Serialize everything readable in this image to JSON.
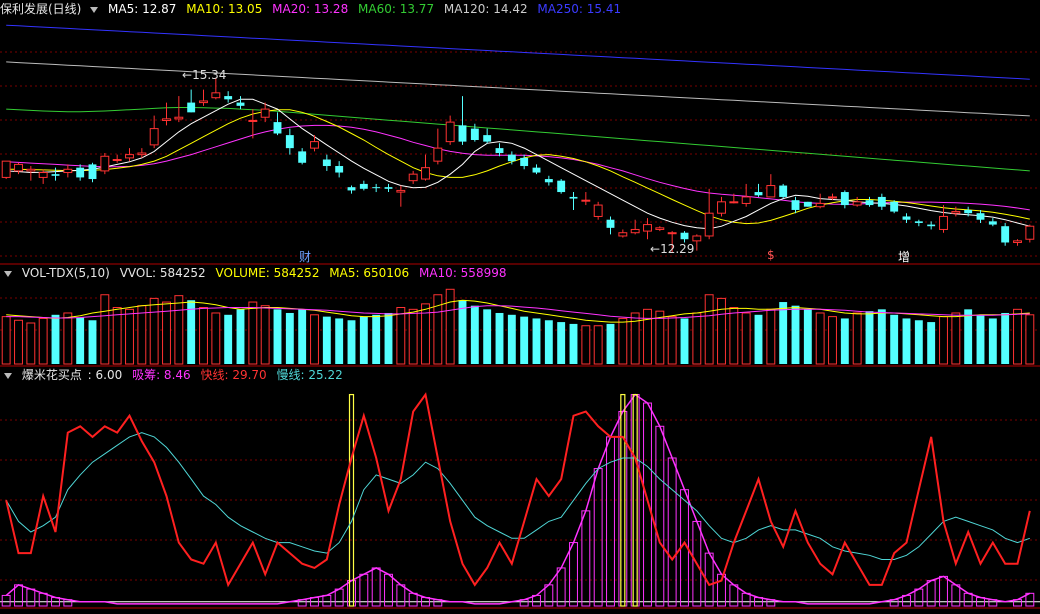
{
  "panel1": {
    "stock_name": "保利发展(日线)",
    "ma5": "MA5: 12.87",
    "ma10": "MA10: 13.05",
    "ma20": "MA20: 13.28",
    "ma60": "MA60: 13.77",
    "ma120": "MA120: 14.42",
    "ma250": "MA250: 15.41",
    "high_label": "15.34",
    "low_label": "12.29",
    "markers": [
      "财",
      "$",
      "增"
    ]
  },
  "panel2": {
    "name": "VOL-TDX(5,10)",
    "vvol": "VVOL: 584252",
    "volume": "VOLUME: 584252",
    "ma5": "MA5: 650106",
    "ma10": "MA10: 558998"
  },
  "panel3": {
    "name": "爆米花买点",
    "value": ": 6.00",
    "xichou": "吸筹: 8.46",
    "kuaixian": "快线: 29.70",
    "manxian": "慢线: 25.22"
  },
  "colors": {
    "up": "#ff3232",
    "down": "#54ffff",
    "ma5": "#ffffff",
    "ma10": "#ffff00",
    "ma20": "#ff33ff",
    "ma60": "#33cc33",
    "ma120": "#bbbbbb",
    "ma250": "#3333ff",
    "grid": "#7a0000",
    "fast": "#ff2020",
    "slow": "#4fd6d6",
    "suck": "#ff33ff",
    "signal": "#ffff44"
  },
  "chart_data": {
    "candles": [
      [
        12.3,
        12.8,
        12.4,
        12.25
      ],
      [
        12.5,
        12.7,
        12.75,
        12.4
      ],
      [
        12.5,
        12.55,
        12.65,
        12.2
      ],
      [
        12.3,
        12.45,
        12.55,
        12.1
      ],
      [
        12.4,
        12.35,
        12.6,
        12.2
      ],
      [
        12.45,
        12.55,
        12.7,
        12.3
      ],
      [
        12.6,
        12.3,
        12.7,
        12.2
      ],
      [
        12.7,
        12.25,
        12.75,
        12.15
      ],
      [
        12.5,
        12.95,
        13.05,
        12.4
      ],
      [
        12.85,
        12.85,
        13.0,
        12.75
      ],
      [
        12.9,
        13.0,
        13.2,
        12.8
      ],
      [
        13.0,
        13.05,
        13.2,
        12.9
      ],
      [
        13.3,
        13.8,
        14.2,
        13.2
      ],
      [
        14.05,
        14.1,
        14.6,
        13.9
      ],
      [
        14.1,
        14.15,
        14.8,
        14.0
      ],
      [
        14.6,
        14.3,
        15.0,
        14.3
      ],
      [
        14.6,
        14.65,
        15.0,
        14.5
      ],
      [
        14.75,
        14.9,
        15.34,
        14.7
      ],
      [
        14.8,
        14.7,
        14.95,
        14.6
      ],
      [
        14.6,
        14.5,
        14.8,
        14.4
      ],
      [
        14.05,
        14.05,
        14.4,
        13.5
      ],
      [
        14.15,
        14.4,
        14.6,
        14.0
      ],
      [
        14.0,
        13.65,
        14.3,
        13.6
      ],
      [
        13.6,
        13.2,
        13.8,
        13.0
      ],
      [
        13.1,
        12.75,
        13.2,
        12.7
      ],
      [
        13.2,
        13.4,
        13.6,
        13.1
      ],
      [
        12.85,
        12.65,
        13.0,
        12.5
      ],
      [
        12.65,
        12.45,
        12.8,
        12.3
      ],
      [
        12.0,
        11.9,
        12.05,
        11.8
      ],
      [
        12.1,
        11.95,
        12.2,
        11.9
      ],
      [
        12.0,
        11.98,
        12.1,
        11.85
      ],
      [
        12.0,
        11.95,
        12.1,
        11.85
      ],
      [
        11.85,
        11.9,
        12.05,
        11.4
      ],
      [
        12.2,
        12.4,
        12.5,
        12.1
      ],
      [
        12.25,
        12.6,
        13.0,
        12.2
      ],
      [
        12.8,
        13.2,
        13.8,
        12.7
      ],
      [
        13.4,
        14.0,
        14.2,
        13.3
      ],
      [
        13.9,
        13.4,
        14.8,
        13.3
      ],
      [
        13.8,
        13.45,
        13.95,
        13.4
      ],
      [
        13.6,
        13.4,
        13.8,
        13.35
      ],
      [
        13.2,
        13.05,
        13.35,
        12.95
      ],
      [
        13.0,
        12.8,
        13.1,
        12.7
      ],
      [
        12.9,
        12.65,
        13.0,
        12.55
      ],
      [
        12.6,
        12.45,
        12.7,
        12.4
      ],
      [
        12.25,
        12.15,
        12.35,
        12.05
      ],
      [
        12.2,
        11.85,
        12.25,
        11.8
      ],
      [
        11.7,
        11.65,
        11.85,
        11.3
      ],
      [
        11.6,
        11.6,
        11.85,
        11.45
      ],
      [
        11.1,
        11.45,
        11.55,
        11.0
      ],
      [
        11.0,
        10.75,
        11.1,
        10.55
      ],
      [
        10.5,
        10.6,
        10.7,
        10.45
      ],
      [
        10.6,
        10.7,
        11.0,
        10.55
      ],
      [
        10.65,
        10.85,
        11.05,
        10.4
      ],
      [
        10.7,
        10.75,
        10.8,
        10.65
      ],
      [
        10.6,
        10.6,
        10.65,
        10.0
      ],
      [
        10.6,
        10.4,
        10.65,
        10.3
      ],
      [
        10.35,
        10.5,
        10.55,
        10.05
      ],
      [
        10.5,
        11.2,
        11.95,
        10.4
      ],
      [
        11.2,
        11.55,
        11.7,
        11.1
      ],
      [
        11.55,
        11.55,
        11.8,
        11.5
      ],
      [
        11.5,
        11.7,
        12.1,
        11.4
      ],
      [
        11.85,
        11.75,
        12.1,
        11.7
      ],
      [
        11.7,
        12.05,
        12.4,
        11.7
      ],
      [
        12.05,
        11.7,
        12.1,
        11.65
      ],
      [
        11.6,
        11.3,
        11.7,
        11.2
      ],
      [
        11.55,
        11.4,
        11.55,
        11.4
      ],
      [
        11.4,
        11.5,
        11.8,
        11.35
      ],
      [
        11.7,
        11.7,
        11.8,
        11.6
      ],
      [
        11.85,
        11.45,
        11.9,
        11.35
      ],
      [
        11.45,
        11.55,
        11.7,
        11.4
      ],
      [
        11.6,
        11.45,
        11.7,
        11.4
      ],
      [
        11.7,
        11.4,
        11.8,
        11.3
      ],
      [
        11.55,
        11.25,
        11.6,
        11.2
      ],
      [
        11.1,
        11.0,
        11.2,
        10.9
      ],
      [
        10.95,
        10.9,
        11.0,
        10.8
      ],
      [
        10.85,
        10.8,
        10.95,
        10.7
      ],
      [
        10.7,
        11.1,
        11.45,
        10.6
      ],
      [
        11.2,
        11.25,
        11.4,
        11.1
      ],
      [
        11.3,
        11.2,
        11.4,
        11.1
      ],
      [
        11.2,
        11.0,
        11.3,
        10.9
      ],
      [
        10.95,
        10.85,
        11.05,
        10.8
      ],
      [
        10.8,
        10.3,
        10.9,
        10.2
      ],
      [
        10.3,
        10.35,
        10.4,
        10.2
      ],
      [
        10.4,
        10.8,
        10.85,
        10.3
      ]
    ],
    "ma5": [
      12.5,
      12.48,
      12.45,
      12.46,
      12.48,
      12.5,
      12.52,
      12.55,
      12.62,
      12.7,
      12.78,
      12.9,
      13.1,
      13.4,
      13.7,
      13.95,
      14.15,
      14.35,
      14.55,
      14.7,
      14.7,
      14.55,
      14.4,
      14.1,
      13.8,
      13.55,
      13.3,
      13.05,
      12.8,
      12.58,
      12.38,
      12.18,
      12.05,
      11.98,
      12.0,
      12.15,
      12.4,
      12.7,
      13.1,
      13.35,
      13.4,
      13.35,
      13.2,
      13.0,
      12.8,
      12.6,
      12.4,
      12.2,
      12.0,
      11.8,
      11.6,
      11.4,
      11.2,
      11.05,
      10.92,
      10.82,
      10.75,
      10.72,
      10.8,
      10.95,
      11.1,
      11.3,
      11.5,
      11.65,
      11.75,
      11.72,
      11.65,
      11.62,
      11.6,
      11.55,
      11.52,
      11.5,
      11.47,
      11.42,
      11.35,
      11.28,
      11.22,
      11.18,
      11.15,
      11.12,
      11.08,
      11.0,
      10.9,
      10.8
    ],
    "ma10": [
      12.55,
      12.55,
      12.54,
      12.53,
      12.52,
      12.51,
      12.51,
      12.52,
      12.54,
      12.58,
      12.63,
      12.7,
      12.8,
      12.95,
      13.15,
      13.35,
      13.55,
      13.75,
      13.95,
      14.12,
      14.25,
      14.33,
      14.38,
      14.38,
      14.3,
      14.18,
      14.02,
      13.85,
      13.65,
      13.45,
      13.22,
      13.0,
      12.8,
      12.6,
      12.45,
      12.35,
      12.3,
      12.3,
      12.38,
      12.5,
      12.65,
      12.78,
      12.9,
      12.98,
      13.0,
      12.95,
      12.88,
      12.78,
      12.65,
      12.5,
      12.32,
      12.15,
      11.97,
      11.8,
      11.62,
      11.45,
      11.28,
      11.12,
      11.0,
      10.92,
      10.88,
      10.9,
      10.98,
      11.1,
      11.22,
      11.35,
      11.45,
      11.52,
      11.58,
      11.62,
      11.62,
      11.6,
      11.57,
      11.53,
      11.48,
      11.42,
      11.37,
      11.33,
      11.3,
      11.27,
      11.23,
      11.17,
      11.1,
      11.02
    ],
    "ma20": [
      12.78,
      12.76,
      12.74,
      12.72,
      12.7,
      12.68,
      12.66,
      12.64,
      12.63,
      12.63,
      12.64,
      12.67,
      12.72,
      12.8,
      12.9,
      13.0,
      13.12,
      13.24,
      13.36,
      13.48,
      13.6,
      13.7,
      13.78,
      13.84,
      13.88,
      13.9,
      13.9,
      13.88,
      13.84,
      13.78,
      13.7,
      13.6,
      13.5,
      13.38,
      13.28,
      13.18,
      13.1,
      13.04,
      13.0,
      12.98,
      12.98,
      12.98,
      12.98,
      12.96,
      12.94,
      12.9,
      12.85,
      12.78,
      12.7,
      12.6,
      12.5,
      12.38,
      12.26,
      12.15,
      12.05,
      11.96,
      11.88,
      11.82,
      11.78,
      11.75,
      11.72,
      11.68,
      11.64,
      11.6,
      11.55,
      11.52,
      11.5,
      11.48,
      11.47,
      11.48,
      11.5,
      11.52,
      11.53,
      11.54,
      11.54,
      11.54,
      11.53,
      11.52,
      11.5,
      11.48,
      11.45,
      11.41,
      11.36,
      11.3
    ],
    "ma60": [
      14.4,
      14.38,
      14.36,
      14.34,
      14.33,
      14.32,
      14.32,
      14.33,
      14.34,
      14.36,
      14.38,
      14.4,
      14.42,
      14.44,
      14.45,
      14.45,
      14.44,
      14.43,
      14.42,
      14.4,
      14.38,
      14.36,
      14.33,
      14.3,
      14.27,
      14.24,
      14.21,
      14.18,
      14.15,
      14.12,
      14.09,
      14.06,
      14.03,
      14.0,
      13.97,
      13.94,
      13.91,
      13.88,
      13.85,
      13.82,
      13.79,
      13.76,
      13.73,
      13.7,
      13.67,
      13.64,
      13.61,
      13.58,
      13.55,
      13.52,
      13.49,
      13.46,
      13.43,
      13.4,
      13.37,
      13.34,
      13.31,
      13.28,
      13.25,
      13.22,
      13.19,
      13.16,
      13.13,
      13.1,
      13.07,
      13.04,
      13.01,
      12.98,
      12.95,
      12.92,
      12.89,
      12.86,
      12.83,
      12.8,
      12.77,
      12.74,
      12.71,
      12.68,
      12.65,
      12.62,
      12.59,
      12.56,
      12.53,
      12.5
    ],
    "ma120": [
      15.85,
      15.83,
      15.81,
      15.79,
      15.77,
      15.75,
      15.73,
      15.71,
      15.69,
      15.67,
      15.65,
      15.63,
      15.61,
      15.59,
      15.57,
      15.55,
      15.53,
      15.51,
      15.49,
      15.47,
      15.45,
      15.43,
      15.41,
      15.39,
      15.37,
      15.35,
      15.33,
      15.31,
      15.29,
      15.27,
      15.25,
      15.23,
      15.21,
      15.19,
      15.17,
      15.15,
      15.13,
      15.11,
      15.09,
      15.07,
      15.05,
      15.03,
      15.01,
      14.99,
      14.97,
      14.95,
      14.93,
      14.91,
      14.89,
      14.87,
      14.85,
      14.83,
      14.81,
      14.79,
      14.77,
      14.75,
      14.73,
      14.71,
      14.69,
      14.67,
      14.65,
      14.63,
      14.61,
      14.59,
      14.57,
      14.55,
      14.53,
      14.51,
      14.49,
      14.47,
      14.45,
      14.43,
      14.41,
      14.39,
      14.37,
      14.35,
      14.33,
      14.31,
      14.29,
      14.27,
      14.25,
      14.23,
      14.21,
      14.19
    ],
    "ma250": [
      16.98,
      16.96,
      16.94,
      16.92,
      16.9,
      16.88,
      16.86,
      16.84,
      16.82,
      16.8,
      16.78,
      16.76,
      16.74,
      16.72,
      16.7,
      16.68,
      16.66,
      16.64,
      16.62,
      16.6,
      16.58,
      16.56,
      16.54,
      16.52,
      16.5,
      16.48,
      16.46,
      16.44,
      16.42,
      16.4,
      16.38,
      16.36,
      16.34,
      16.32,
      16.3,
      16.28,
      16.26,
      16.24,
      16.22,
      16.2,
      16.18,
      16.16,
      16.14,
      16.12,
      16.1,
      16.08,
      16.06,
      16.04,
      16.02,
      16.0,
      15.98,
      15.96,
      15.94,
      15.92,
      15.9,
      15.88,
      15.86,
      15.84,
      15.82,
      15.8,
      15.78,
      15.76,
      15.74,
      15.72,
      15.7,
      15.68,
      15.66,
      15.64,
      15.62,
      15.6,
      15.58,
      15.56,
      15.54,
      15.52,
      15.5,
      15.48,
      15.46,
      15.44,
      15.42,
      15.4,
      15.38,
      15.36,
      15.34,
      15.32
    ],
    "price_range": [
      9.7,
      17.2
    ],
    "volume": [
      520,
      480,
      450,
      500,
      540,
      560,
      510,
      480,
      760,
      620,
      600,
      640,
      720,
      680,
      750,
      700,
      620,
      560,
      540,
      600,
      680,
      640,
      600,
      560,
      600,
      540,
      520,
      500,
      480,
      520,
      540,
      560,
      620,
      600,
      660,
      760,
      820,
      700,
      640,
      600,
      560,
      540,
      520,
      500,
      480,
      460,
      440,
      420,
      420,
      440,
      500,
      560,
      600,
      580,
      520,
      500,
      560,
      760,
      720,
      620,
      560,
      540,
      600,
      680,
      640,
      600,
      560,
      520,
      500,
      560,
      580,
      600,
      540,
      500,
      480,
      460,
      520,
      560,
      600,
      540,
      500,
      560,
      600,
      540
    ],
    "volume_range": [
      0,
      900
    ],
    "vol_ma5": [
      540,
      530,
      520,
      510,
      500,
      510,
      530,
      560,
      580,
      600,
      620,
      640,
      650,
      660,
      670,
      680,
      670,
      650,
      620,
      600,
      610,
      620,
      620,
      610,
      600,
      590,
      570,
      550,
      530,
      520,
      520,
      530,
      550,
      570,
      600,
      640,
      680,
      700,
      690,
      670,
      640,
      610,
      580,
      560,
      540,
      520,
      500,
      480,
      470,
      460,
      460,
      470,
      490,
      510,
      530,
      550,
      560,
      580,
      600,
      610,
      610,
      600,
      600,
      610,
      620,
      610,
      600,
      580,
      560,
      550,
      550,
      560,
      560,
      550,
      540,
      530,
      520,
      520,
      530,
      540,
      540,
      540,
      550,
      560
    ],
    "vol_ma10": [
      520,
      520,
      515,
      510,
      505,
      505,
      510,
      520,
      530,
      540,
      550,
      560,
      570,
      580,
      590,
      600,
      610,
      615,
      620,
      620,
      620,
      615,
      610,
      605,
      600,
      595,
      590,
      580,
      570,
      560,
      555,
      550,
      550,
      555,
      560,
      570,
      590,
      610,
      630,
      640,
      640,
      635,
      625,
      615,
      600,
      585,
      570,
      555,
      540,
      525,
      515,
      505,
      500,
      500,
      505,
      510,
      520,
      530,
      545,
      560,
      570,
      580,
      590,
      595,
      600,
      600,
      600,
      595,
      590,
      580,
      570,
      565,
      560,
      555,
      550,
      545,
      540,
      535,
      535,
      535,
      535,
      540,
      545,
      550
    ],
    "fast": [
      50,
      25,
      25,
      52,
      35,
      82,
      85,
      80,
      85,
      82,
      90,
      78,
      68,
      52,
      30,
      22,
      20,
      30,
      10,
      20,
      30,
      15,
      30,
      25,
      20,
      18,
      22,
      48,
      70,
      90,
      70,
      45,
      60,
      92,
      100,
      70,
      40,
      20,
      10,
      18,
      30,
      20,
      40,
      60,
      52,
      60,
      90,
      92,
      85,
      80,
      80,
      70,
      50,
      30,
      22,
      30,
      20,
      10,
      12,
      30,
      45,
      60,
      40,
      28,
      45,
      30,
      20,
      15,
      30,
      20,
      10,
      10,
      25,
      30,
      55,
      80,
      40,
      20,
      35,
      20,
      30,
      20,
      20,
      45
    ],
    "slow": [
      50,
      40,
      35,
      38,
      42,
      55,
      62,
      68,
      72,
      76,
      80,
      82,
      80,
      75,
      68,
      60,
      52,
      48,
      42,
      38,
      35,
      32,
      30,
      30,
      28,
      26,
      25,
      30,
      40,
      55,
      62,
      60,
      58,
      62,
      68,
      65,
      58,
      50,
      42,
      38,
      35,
      32,
      32,
      36,
      40,
      42,
      50,
      58,
      65,
      68,
      70,
      70,
      66,
      60,
      55,
      50,
      45,
      38,
      32,
      30,
      32,
      36,
      38,
      36,
      36,
      34,
      32,
      28,
      26,
      25,
      24,
      22,
      22,
      24,
      28,
      34,
      40,
      42,
      40,
      38,
      36,
      32,
      30,
      32
    ],
    "suck": [
      5,
      10,
      8,
      6,
      4,
      3,
      2,
      2,
      2,
      1,
      1,
      1,
      1,
      1,
      1,
      1,
      1,
      1,
      1,
      1,
      1,
      1,
      1,
      2,
      3,
      4,
      5,
      8,
      12,
      15,
      18,
      15,
      10,
      6,
      4,
      3,
      2,
      2,
      1,
      1,
      1,
      2,
      3,
      5,
      10,
      18,
      30,
      45,
      65,
      80,
      92,
      100,
      96,
      85,
      70,
      55,
      40,
      25,
      15,
      10,
      6,
      4,
      3,
      2,
      2,
      1,
      1,
      1,
      1,
      1,
      1,
      2,
      3,
      5,
      8,
      12,
      14,
      10,
      6,
      4,
      3,
      2,
      3,
      6
    ],
    "signal_bars": [
      {
        "index": 28,
        "value": 100
      },
      {
        "index": 50,
        "value": 100
      },
      {
        "index": 51,
        "value": 100
      }
    ],
    "indicator_range": [
      0,
      105
    ]
  }
}
